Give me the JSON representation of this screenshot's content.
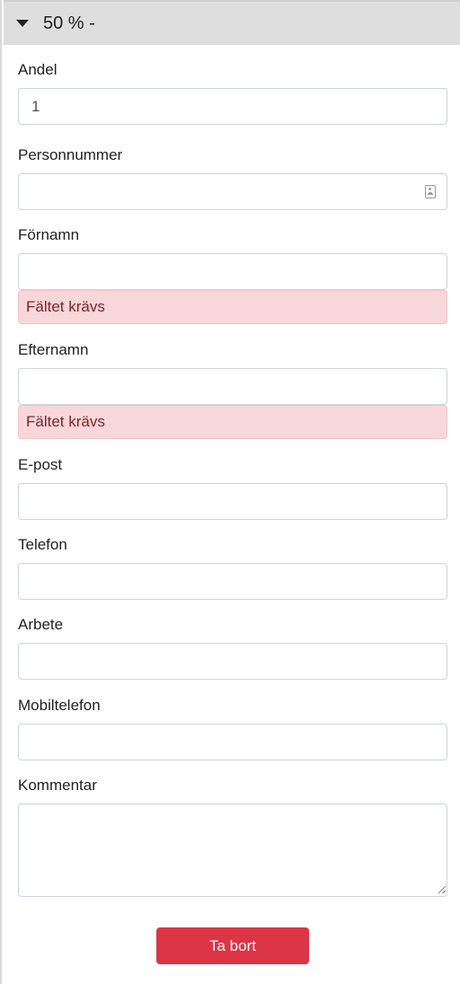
{
  "section": {
    "title": "50 % -",
    "caret_icon": "caret-down-icon"
  },
  "fields": {
    "andel": {
      "label": "Andel",
      "value": "1"
    },
    "personnummer": {
      "label": "Personnummer",
      "value": "",
      "icon": "contact-card-icon"
    },
    "fornamn": {
      "label": "Förnamn",
      "value": "",
      "error": "Fältet krävs"
    },
    "efternamn": {
      "label": "Efternamn",
      "value": "",
      "error": "Fältet krävs"
    },
    "epost": {
      "label": "E-post",
      "value": ""
    },
    "telefon": {
      "label": "Telefon",
      "value": ""
    },
    "arbete": {
      "label": "Arbete",
      "value": ""
    },
    "mobiltelefon": {
      "label": "Mobiltelefon",
      "value": ""
    },
    "kommentar": {
      "label": "Kommentar",
      "value": ""
    }
  },
  "actions": {
    "delete_label": "Ta bort"
  },
  "colors": {
    "danger": "#dc3545",
    "error_bg": "#f8d7da",
    "error_text": "#842029",
    "header_bg": "#dedede"
  }
}
